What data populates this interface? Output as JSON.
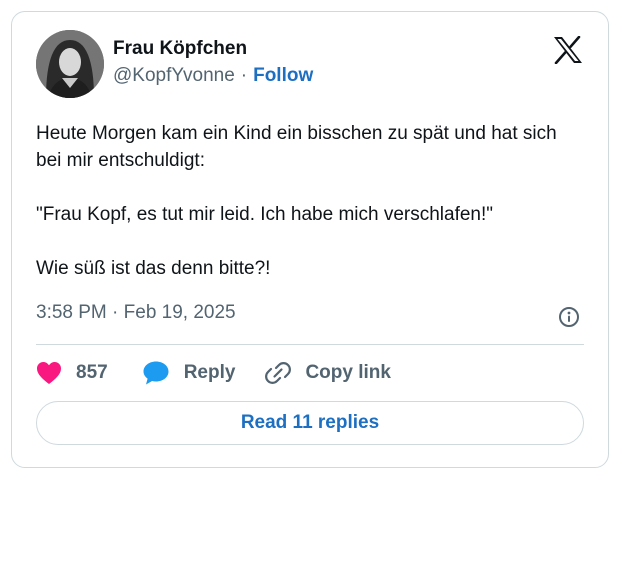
{
  "tweet": {
    "author_name": "Frau Köpfchen",
    "handle": "@KopfYvonne",
    "separator": "·",
    "follow_label": "Follow",
    "body": {
      "line1": "Heute Morgen kam ein Kind ein bisschen zu spät und hat sich bei mir entschuldigt:",
      "line2": "\"Frau Kopf, es tut mir leid. Ich habe mich verschlafen!\"",
      "line3": "Wie süß ist das denn bitte?!"
    },
    "timestamp": "3:58 PM · Feb 19, 2025",
    "likes": "857",
    "reply_label": "Reply",
    "copy_link_label": "Copy link",
    "read_replies_label": "Read 11 replies"
  },
  "icons": {
    "logo": "x-logo-icon",
    "info": "info-icon",
    "like": "heart-icon",
    "reply": "speech-bubble-icon",
    "copy": "link-icon"
  },
  "colors": {
    "like": "#f91880",
    "reply": "#1d9bf0",
    "link_accent": "#1d6fc2",
    "muted_text": "#536471",
    "border": "#cfd9de"
  }
}
